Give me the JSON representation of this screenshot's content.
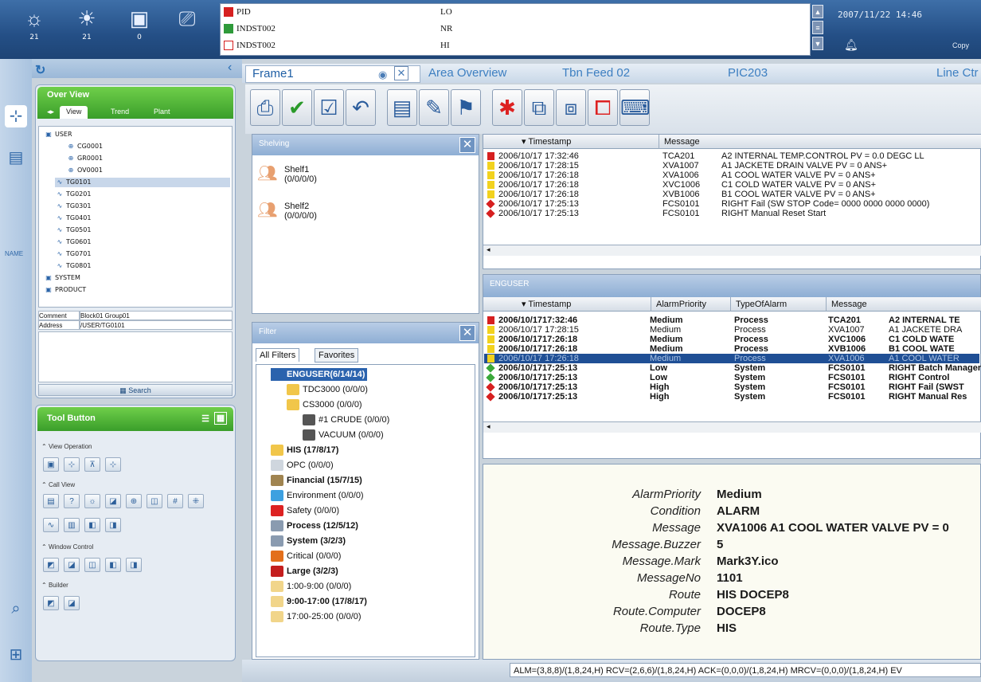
{
  "top_buttons": [
    {
      "icon": "sun-icon",
      "count": "21"
    },
    {
      "icon": "sun-icon",
      "count": "21"
    },
    {
      "icon": "tag-icon",
      "count": "0"
    },
    {
      "icon": "monitor-icon",
      "count": ""
    }
  ],
  "process_alarms": [
    {
      "name": "PID",
      "state": "LO",
      "color": "#d62020"
    },
    {
      "name": "INDST002",
      "state": "NR",
      "color": "#2e9a3a"
    },
    {
      "name": "INDST002",
      "state": "HI",
      "color": "#ffffff"
    }
  ],
  "datetime": "2007/11/22 14:46",
  "copy": "Copy",
  "left_strip": {
    "name_label": "NAME"
  },
  "overview": {
    "title": "Over View",
    "tabs": [
      "View",
      "Trend",
      "Plant"
    ],
    "tree": [
      {
        "label": "USER",
        "level": 0
      },
      {
        "label": "CG0001",
        "level": 2
      },
      {
        "label": "GR0001",
        "level": 2
      },
      {
        "label": "OV0001",
        "level": 2
      },
      {
        "label": "TG0101",
        "level": 1,
        "selected": true
      },
      {
        "label": "TG0201",
        "level": 1
      },
      {
        "label": "TG0301",
        "level": 1
      },
      {
        "label": "TG0401",
        "level": 1
      },
      {
        "label": "TG0501",
        "level": 1
      },
      {
        "label": "TG0601",
        "level": 1
      },
      {
        "label": "TG0701",
        "level": 1
      },
      {
        "label": "TG0801",
        "level": 1
      },
      {
        "label": "SYSTEM",
        "level": 0
      },
      {
        "label": "PRODUCT",
        "level": 0
      }
    ],
    "comment_label": "Comment",
    "comment_value": "Block01 Group01",
    "address_label": "Address",
    "address_value": "/USER/TG0101",
    "search_label": "Search"
  },
  "tool_button": {
    "title": "Tool Button",
    "sections": [
      "View Operation",
      "Call View",
      "Window Control",
      "Builder"
    ]
  },
  "tabs": {
    "frame": "Frame1",
    "area": "Area Overview",
    "tbn": "Tbn Feed 02",
    "pic": "PIC203",
    "line": "Line Ctr"
  },
  "shelving": {
    "title": "Shelving",
    "items": [
      {
        "name": "Shelf1",
        "counts": "(0/0/0/0)"
      },
      {
        "name": "Shelf2",
        "counts": "(0/0/0/0)"
      }
    ]
  },
  "filter": {
    "title": "Filter",
    "tabs": [
      "All Filters",
      "Favorites"
    ],
    "items": [
      {
        "label": "ENGUSER(6/14/14)",
        "bold": true,
        "selected": true
      },
      {
        "label": "TDC3000 (0/0/0)",
        "bold": false
      },
      {
        "label": "CS3000 (0/0/0)",
        "bold": false
      },
      {
        "label": "#1 CRUDE (0/0/0)",
        "bold": false
      },
      {
        "label": "VACUUM (0/0/0)",
        "bold": false
      },
      {
        "label": "HIS (17/8/17)",
        "bold": true
      },
      {
        "label": "OPC (0/0/0)",
        "bold": false
      },
      {
        "label": "Financial (15/7/15)",
        "bold": true
      },
      {
        "label": "Environment (0/0/0)",
        "bold": false
      },
      {
        "label": "Safety (0/0/0)",
        "bold": false
      },
      {
        "label": "Process (12/5/12)",
        "bold": true
      },
      {
        "label": "System (3/2/3)",
        "bold": true
      },
      {
        "label": "Critical (0/0/0)",
        "bold": false
      },
      {
        "label": "Large (3/2/3)",
        "bold": true
      },
      {
        "label": "1:00-9:00 (0/0/0)",
        "bold": false
      },
      {
        "label": "9:00-17:00 (17/8/17)",
        "bold": true
      },
      {
        "label": "17:00-25:00 (0/0/0)",
        "bold": false
      }
    ]
  },
  "top_list": {
    "headers": [
      "Timestamp",
      "Message"
    ],
    "rows": [
      {
        "marker": "#d62020",
        "ts": "2006/10/17 17:32:46",
        "tag": "TCA201",
        "msg": "A2 INTERNAL TEMP.CONTROL PV =   0.0 DEGC LL"
      },
      {
        "marker": "#f2d21e",
        "ts": "2006/10/17 17:28:15",
        "tag": "XVA1007",
        "msg": "A1 JACKETE DRAIN VALVE  PV =    0    ANS+"
      },
      {
        "marker": "#f2d21e",
        "ts": "2006/10/17 17:26:18",
        "tag": "XVA1006",
        "msg": "A1 COOL WATER VALVE     PV =    0    ANS+"
      },
      {
        "marker": "#f2d21e",
        "ts": "2006/10/17 17:26:18",
        "tag": "XVC1006",
        "msg": "C1 COLD WATER VALVE     PV =    0    ANS+"
      },
      {
        "marker": "#f2d21e",
        "ts": "2006/10/17 17:26:18",
        "tag": "XVB1006",
        "msg": "B1 COOL WATER VALVE     PV =    0    ANS+"
      },
      {
        "marker": "#d62020",
        "ts": "2006/10/17 17:25:13",
        "tag": "FCS0101",
        "msg": "RIGHT   Fail (SW STOP  Code= 0000 0000 0000 0000)"
      },
      {
        "marker": "#d62020",
        "ts": "2006/10/17 17:25:13",
        "tag": "FCS0101",
        "msg": "RIGHT   Manual Reset Start"
      }
    ]
  },
  "enguser_list": {
    "title": "ENGUSER",
    "headers": [
      "Timestamp",
      "AlarmPriority",
      "TypeOfAlarm",
      "Message"
    ],
    "rows": [
      {
        "marker": "#d62020",
        "ts": "2006/10/1717:32:46",
        "pri": "Medium",
        "type": "Process",
        "tag": "TCA201",
        "msg": "A2 INTERNAL TE",
        "bold": true
      },
      {
        "marker": "#f2d21e",
        "ts": "2006/10/17 17:28:15",
        "pri": "Medium",
        "type": "Process",
        "tag": "XVA1007",
        "msg": "A1 JACKETE DRA",
        "bold": false
      },
      {
        "marker": "#f2d21e",
        "ts": "2006/10/1717:26:18",
        "pri": "Medium",
        "type": "Process",
        "tag": "XVC1006",
        "msg": "C1 COLD WATE",
        "bold": true
      },
      {
        "marker": "#f2d21e",
        "ts": "2006/10/1717:26:18",
        "pri": "Medium",
        "type": "Process",
        "tag": "XVB1006",
        "msg": "B1 COOL WATE",
        "bold": true
      },
      {
        "marker": "#f2d21e",
        "ts": "2006/10/17 17:26:18",
        "pri": "Medium",
        "type": "Process",
        "tag": "XVA1006",
        "msg": "A1 COOL WATER",
        "bold": false,
        "selected": true
      },
      {
        "marker": "#3aa83a",
        "ts": "2006/10/1717:25:13",
        "pri": "Low",
        "type": "System",
        "tag": "FCS0101",
        "msg": "RIGHT Batch Manager Rea",
        "bold": true
      },
      {
        "marker": "#3aa83a",
        "ts": "2006/10/1717:25:13",
        "pri": "Low",
        "type": "System",
        "tag": "FCS0101",
        "msg": "RIGHT  Control",
        "bold": true
      },
      {
        "marker": "#d62020",
        "ts": "2006/10/1717:25:13",
        "pri": "High",
        "type": "System",
        "tag": "FCS0101",
        "msg": "RIGHT  Fail (SWST",
        "bold": true
      },
      {
        "marker": "#d62020",
        "ts": "2006/10/1717:25:13",
        "pri": "High",
        "type": "System",
        "tag": "FCS0101",
        "msg": "RIGHT  Manual Res",
        "bold": true
      }
    ]
  },
  "detail": [
    {
      "k": "AlarmPriority",
      "v": "Medium"
    },
    {
      "k": "Condition",
      "v": "ALARM"
    },
    {
      "k": "Message",
      "v": "XVA1006 A1 COOL WATER VALVE PV = 0"
    },
    {
      "k": "Message.Buzzer",
      "v": "5"
    },
    {
      "k": "Message.Mark",
      "v": "Mark3Y.ico"
    },
    {
      "k": "MessageNo",
      "v": "1101"
    },
    {
      "k": "Route",
      "v": "HIS DOCEP8"
    },
    {
      "k": "Route.Computer",
      "v": "DOCEP8"
    },
    {
      "k": "Route.Type",
      "v": "HIS"
    }
  ],
  "status": "ALM=(3,8,8)/(1,8,24,H) RCV=(2,6,6)/(1,8,24,H) ACK=(0,0,0)/(1,8,24,H) MRCV=(0,0,0)/(1,8,24,H) EV"
}
